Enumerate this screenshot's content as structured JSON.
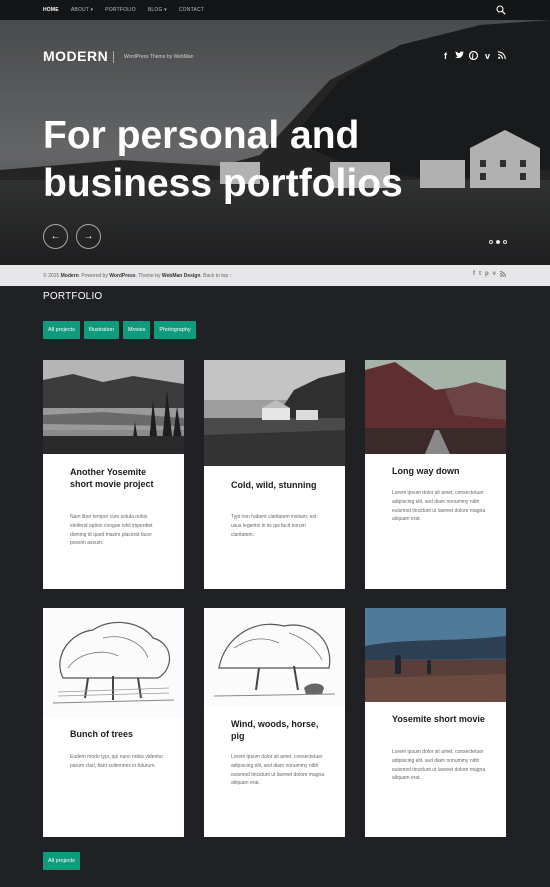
{
  "nav": {
    "items": [
      {
        "label": "HOME",
        "active": true
      },
      {
        "label": "ABOUT ▾",
        "active": false
      },
      {
        "label": "PORTFOLIO",
        "active": false
      },
      {
        "label": "BLOG ▾",
        "active": false
      },
      {
        "label": "CONTACT",
        "active": false
      }
    ],
    "search_icon": "search-icon"
  },
  "hero": {
    "brand": "MODERN",
    "tagline": "WordPress Theme by WebMan",
    "social": [
      "f",
      "t",
      "p",
      "v",
      "rss"
    ],
    "headline_line1": "For personal and",
    "headline_line2": "business portfolios",
    "prev_arrow": "←",
    "next_arrow": "→"
  },
  "strip": {
    "copyright": "© 2015",
    "site": "Modern",
    "powered": ". Powered by",
    "wp": "WordPress",
    "theme": ". Theme by",
    "author": "WebMan Design",
    "backtop": ". Back to top ↑"
  },
  "portfolio": {
    "title": "PORTFOLIO",
    "filters": [
      "All projects",
      "Illustration",
      "Movies",
      "Photography"
    ],
    "bottom_button": "All projects",
    "cards": [
      {
        "title": "Another Yosemite short movie project",
        "text": "Nam liber tempor cum soluta nobis eleifend option congue nihil imperdiet doming id quod mazim placerat facer possim assum."
      },
      {
        "title": "Cold, wild, stunning",
        "text": "Typi non habent claritatem insitam; est usus legentis in iis qui facit eorum claritatem."
      },
      {
        "title": "Long way down",
        "text": "Lorem ipsum dolor sit amet, consectetuer adipiscing elit, sed diam nonummy nibh euismod tincidunt ut laoreet dolore magna aliquam erat."
      },
      {
        "title": "Bunch of trees",
        "text": "Eodem modo typi, qui nunc nobis videntur parum clari, fiant sollemnes in futurum."
      },
      {
        "title": "Wind, woods, horse, pig",
        "text": "Lorem ipsum dolor sit amet, consectetuer adipiscing elit, sed diam nonummy nibh euismod tincidunt ut laoreet dolore magna aliquam erat."
      },
      {
        "title": "Yosemite short movie",
        "text": "Lorem ipsum dolor sit amet, consectetuer adipiscing elit, sed diam nonummy nibh euismod tincidunt ut laoreet dolore magna aliquam erat."
      }
    ]
  },
  "colors": {
    "accent": "#0f9c7c",
    "background": "#1f2124",
    "nav": "#141516",
    "strip": "#e7e7ea"
  }
}
